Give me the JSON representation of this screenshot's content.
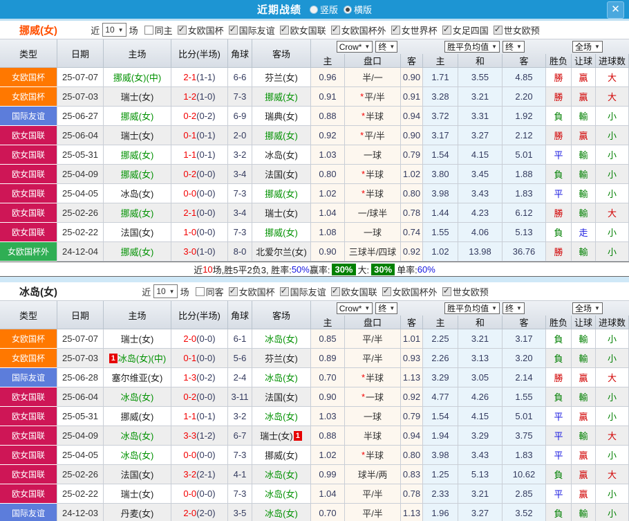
{
  "titlebar": {
    "title": "近期战绩",
    "radios": [
      {
        "label": "竖版",
        "checked": false
      },
      {
        "label": "横版",
        "checked": true
      }
    ],
    "close_label": "✕"
  },
  "colors": {
    "titlebar_bg": "#1d95d3",
    "focus_team": "#019101",
    "score_red": "#f30000"
  },
  "type_colors": {
    "女欧国杯": "#ff7800",
    "国际友谊": "#5c7ddb",
    "欧女国联": "#ce1656",
    "女欧国杯外": "#2fae54"
  },
  "result_colors": {
    "勝": "#d10000",
    "贏": "#d10000",
    "大": "#d10000",
    "負": "#018001",
    "輸": "#018001",
    "小": "#018001",
    "平": "#1a1ae0",
    "走": "#1a1ae0"
  },
  "table_header": {
    "cols": [
      "类型",
      "日期",
      "主场",
      "比分(半场)",
      "角球",
      "客场"
    ],
    "crow": "Crow*",
    "end": "终",
    "avg": "胜平负均值",
    "full": "全场",
    "arrow": "▼",
    "sub": [
      "主",
      "盘口",
      "客",
      "主",
      "和",
      "客",
      "胜负",
      "让球",
      "进球数"
    ]
  },
  "sections": [
    {
      "team": "挪威(女)",
      "team_color": "#ff5000",
      "filter": {
        "near": "近",
        "count": "10",
        "unit": "场",
        "same": {
          "label": "同主",
          "checked": false
        },
        "leagues": [
          {
            "label": "女欧国杯",
            "checked": true
          },
          {
            "label": "国际友谊",
            "checked": true
          },
          {
            "label": "欧女国联",
            "checked": true
          },
          {
            "label": "女欧国杯外",
            "checked": true
          },
          {
            "label": "女世界杯",
            "checked": true
          },
          {
            "label": "女足四国",
            "checked": true
          },
          {
            "label": "世女欧预",
            "checked": true
          }
        ]
      },
      "rows": [
        {
          "type": "女欧国杯",
          "date": "25-07-07",
          "home": {
            "name": "挪威(女)",
            "focus": true,
            "suffix": "(中)"
          },
          "score": "2-1",
          "half": "(1-1)",
          "corner": "6-6",
          "away": {
            "name": "芬兰(女)"
          },
          "o1": "0.96",
          "star": false,
          "pk": "半/一",
          "o2": "0.90",
          "avg": [
            "1.71",
            "3.55",
            "4.85"
          ],
          "res": [
            "勝",
            "贏",
            "大"
          ]
        },
        {
          "type": "女欧国杯",
          "date": "25-07-03",
          "home": {
            "name": "瑞士(女)"
          },
          "score": "1-2",
          "half": "(1-0)",
          "corner": "7-3",
          "away": {
            "name": "挪威(女)",
            "focus": true
          },
          "o1": "0.91",
          "star": true,
          "pk": "平/半",
          "o2": "0.91",
          "avg": [
            "3.28",
            "3.21",
            "2.20"
          ],
          "res": [
            "勝",
            "贏",
            "大"
          ]
        },
        {
          "type": "国际友谊",
          "date": "25-06-27",
          "home": {
            "name": "挪威(女)",
            "focus": true
          },
          "score": "0-2",
          "half": "(0-2)",
          "corner": "6-9",
          "away": {
            "name": "瑞典(女)"
          },
          "o1": "0.88",
          "star": true,
          "pk": "半球",
          "o2": "0.94",
          "avg": [
            "3.72",
            "3.31",
            "1.92"
          ],
          "res": [
            "負",
            "輸",
            "小"
          ]
        },
        {
          "type": "欧女国联",
          "date": "25-06-04",
          "home": {
            "name": "瑞士(女)"
          },
          "score": "0-1",
          "half": "(0-1)",
          "corner": "2-0",
          "away": {
            "name": "挪威(女)",
            "focus": true
          },
          "o1": "0.92",
          "star": true,
          "pk": "平/半",
          "o2": "0.90",
          "avg": [
            "3.17",
            "3.27",
            "2.12"
          ],
          "res": [
            "勝",
            "贏",
            "小"
          ]
        },
        {
          "type": "欧女国联",
          "date": "25-05-31",
          "home": {
            "name": "挪威(女)",
            "focus": true
          },
          "score": "1-1",
          "half": "(0-1)",
          "corner": "3-2",
          "away": {
            "name": "冰岛(女)"
          },
          "o1": "1.03",
          "star": false,
          "pk": "一球",
          "o2": "0.79",
          "avg": [
            "1.54",
            "4.15",
            "5.01"
          ],
          "res": [
            "平",
            "輸",
            "小"
          ]
        },
        {
          "type": "欧女国联",
          "date": "25-04-09",
          "home": {
            "name": "挪威(女)",
            "focus": true
          },
          "score": "0-2",
          "half": "(0-0)",
          "corner": "3-4",
          "away": {
            "name": "法国(女)"
          },
          "o1": "0.80",
          "star": true,
          "pk": "半球",
          "o2": "1.02",
          "avg": [
            "3.80",
            "3.45",
            "1.88"
          ],
          "res": [
            "負",
            "輸",
            "小"
          ]
        },
        {
          "type": "欧女国联",
          "date": "25-04-05",
          "home": {
            "name": "冰岛(女)"
          },
          "score": "0-0",
          "half": "(0-0)",
          "corner": "7-3",
          "away": {
            "name": "挪威(女)",
            "focus": true
          },
          "o1": "1.02",
          "star": true,
          "pk": "半球",
          "o2": "0.80",
          "avg": [
            "3.98",
            "3.43",
            "1.83"
          ],
          "res": [
            "平",
            "輸",
            "小"
          ]
        },
        {
          "type": "欧女国联",
          "date": "25-02-26",
          "home": {
            "name": "挪威(女)",
            "focus": true
          },
          "score": "2-1",
          "half": "(0-0)",
          "corner": "3-4",
          "away": {
            "name": "瑞士(女)"
          },
          "o1": "1.04",
          "star": false,
          "pk": "一/球半",
          "o2": "0.78",
          "avg": [
            "1.44",
            "4.23",
            "6.12"
          ],
          "res": [
            "勝",
            "輸",
            "大"
          ]
        },
        {
          "type": "欧女国联",
          "date": "25-02-22",
          "home": {
            "name": "法国(女)"
          },
          "score": "1-0",
          "half": "(0-0)",
          "corner": "7-3",
          "away": {
            "name": "挪威(女)",
            "focus": true
          },
          "o1": "1.08",
          "star": false,
          "pk": "一球",
          "o2": "0.74",
          "avg": [
            "1.55",
            "4.06",
            "5.13"
          ],
          "res": [
            "負",
            "走",
            "小"
          ]
        },
        {
          "type": "女欧国杯外",
          "date": "24-12-04",
          "home": {
            "name": "挪威(女)",
            "focus": true
          },
          "score": "3-0",
          "half": "(1-0)",
          "corner": "8-0",
          "away": {
            "name": "北爱尔兰(女)"
          },
          "o1": "0.90",
          "star": false,
          "pk": "三球半/四球",
          "o2": "0.92",
          "avg": [
            "1.02",
            "13.98",
            "36.76"
          ],
          "res": [
            "勝",
            "輸",
            "小"
          ]
        }
      ],
      "summary": [
        {
          "t": "近"
        },
        {
          "t": "10",
          "c": "red"
        },
        {
          "t": "场,胜5平2负3, 胜率:"
        },
        {
          "t": "50%",
          "c": "blue"
        },
        {
          "t": " 赢率: "
        },
        {
          "t": "30%",
          "c": "box"
        },
        {
          "t": " 大: "
        },
        {
          "t": "30%",
          "c": "box"
        },
        {
          "t": " 单率:"
        },
        {
          "t": "60%",
          "c": "blue"
        }
      ]
    },
    {
      "team": "冰岛(女)",
      "team_color": "#222222",
      "filter": {
        "near": "近",
        "count": "10",
        "unit": "场",
        "same": {
          "label": "同客",
          "checked": false
        },
        "leagues": [
          {
            "label": "女欧国杯",
            "checked": true
          },
          {
            "label": "国际友谊",
            "checked": true
          },
          {
            "label": "欧女国联",
            "checked": true
          },
          {
            "label": "女欧国杯外",
            "checked": true
          },
          {
            "label": "世女欧预",
            "checked": true
          }
        ]
      },
      "rows": [
        {
          "type": "女欧国杯",
          "date": "25-07-07",
          "home": {
            "name": "瑞士(女)"
          },
          "score": "2-0",
          "half": "(0-0)",
          "corner": "6-1",
          "away": {
            "name": "冰岛(女)",
            "focus": true
          },
          "o1": "0.85",
          "star": false,
          "pk": "平/半",
          "o2": "1.01",
          "avg": [
            "2.25",
            "3.21",
            "3.17"
          ],
          "res": [
            "負",
            "輸",
            "小"
          ]
        },
        {
          "type": "女欧国杯",
          "date": "25-07-03",
          "home": {
            "badge_before": "1",
            "name": "冰岛(女)",
            "focus": true,
            "suffix": "(中)"
          },
          "score": "0-1",
          "half": "(0-0)",
          "corner": "5-6",
          "away": {
            "name": "芬兰(女)"
          },
          "o1": "0.89",
          "star": false,
          "pk": "平/半",
          "o2": "0.93",
          "avg": [
            "2.26",
            "3.13",
            "3.20"
          ],
          "res": [
            "負",
            "輸",
            "小"
          ]
        },
        {
          "type": "国际友谊",
          "date": "25-06-28",
          "home": {
            "name": "塞尔维亚(女)"
          },
          "score": "1-3",
          "half": "(0-2)",
          "corner": "2-4",
          "away": {
            "name": "冰岛(女)",
            "focus": true
          },
          "o1": "0.70",
          "star": true,
          "pk": "半球",
          "o2": "1.13",
          "avg": [
            "3.29",
            "3.05",
            "2.14"
          ],
          "res": [
            "勝",
            "贏",
            "大"
          ]
        },
        {
          "type": "欧女国联",
          "date": "25-06-04",
          "home": {
            "name": "冰岛(女)",
            "focus": true
          },
          "score": "0-2",
          "half": "(0-0)",
          "corner": "3-11",
          "away": {
            "name": "法国(女)"
          },
          "o1": "0.90",
          "star": true,
          "pk": "一球",
          "o2": "0.92",
          "avg": [
            "4.77",
            "4.26",
            "1.55"
          ],
          "res": [
            "負",
            "輸",
            "小"
          ]
        },
        {
          "type": "欧女国联",
          "date": "25-05-31",
          "home": {
            "name": "挪威(女)"
          },
          "score": "1-1",
          "half": "(0-1)",
          "corner": "3-2",
          "away": {
            "name": "冰岛(女)",
            "focus": true
          },
          "o1": "1.03",
          "star": false,
          "pk": "一球",
          "o2": "0.79",
          "avg": [
            "1.54",
            "4.15",
            "5.01"
          ],
          "res": [
            "平",
            "贏",
            "小"
          ]
        },
        {
          "type": "欧女国联",
          "date": "25-04-09",
          "home": {
            "name": "冰岛(女)",
            "focus": true
          },
          "score": "3-3",
          "half": "(1-2)",
          "corner": "6-7",
          "away": {
            "name": "瑞士(女)",
            "badge_after": "1"
          },
          "o1": "0.88",
          "star": false,
          "pk": "半球",
          "o2": "0.94",
          "avg": [
            "1.94",
            "3.29",
            "3.75"
          ],
          "res": [
            "平",
            "輸",
            "大"
          ]
        },
        {
          "type": "欧女国联",
          "date": "25-04-05",
          "home": {
            "name": "冰岛(女)",
            "focus": true
          },
          "score": "0-0",
          "half": "(0-0)",
          "corner": "7-3",
          "away": {
            "name": "挪威(女)"
          },
          "o1": "1.02",
          "star": true,
          "pk": "半球",
          "o2": "0.80",
          "avg": [
            "3.98",
            "3.43",
            "1.83"
          ],
          "res": [
            "平",
            "贏",
            "小"
          ]
        },
        {
          "type": "欧女国联",
          "date": "25-02-26",
          "home": {
            "name": "法国(女)"
          },
          "score": "3-2",
          "half": "(2-1)",
          "corner": "4-1",
          "away": {
            "name": "冰岛(女)",
            "focus": true
          },
          "o1": "0.99",
          "star": false,
          "pk": "球半/两",
          "o2": "0.83",
          "avg": [
            "1.25",
            "5.13",
            "10.62"
          ],
          "res": [
            "負",
            "贏",
            "大"
          ]
        },
        {
          "type": "欧女国联",
          "date": "25-02-22",
          "home": {
            "name": "瑞士(女)"
          },
          "score": "0-0",
          "half": "(0-0)",
          "corner": "7-3",
          "away": {
            "name": "冰岛(女)",
            "focus": true
          },
          "o1": "1.04",
          "star": false,
          "pk": "平/半",
          "o2": "0.78",
          "avg": [
            "2.33",
            "3.21",
            "2.85"
          ],
          "res": [
            "平",
            "贏",
            "小"
          ]
        },
        {
          "type": "国际友谊",
          "date": "24-12-03",
          "home": {
            "name": "丹麦(女)"
          },
          "score": "2-0",
          "half": "(2-0)",
          "corner": "3-5",
          "away": {
            "name": "冰岛(女)",
            "focus": true
          },
          "o1": "0.70",
          "star": false,
          "pk": "平/半",
          "o2": "1.13",
          "avg": [
            "1.96",
            "3.27",
            "3.52"
          ],
          "res": [
            "負",
            "輸",
            "小"
          ]
        }
      ],
      "summary": null
    }
  ]
}
